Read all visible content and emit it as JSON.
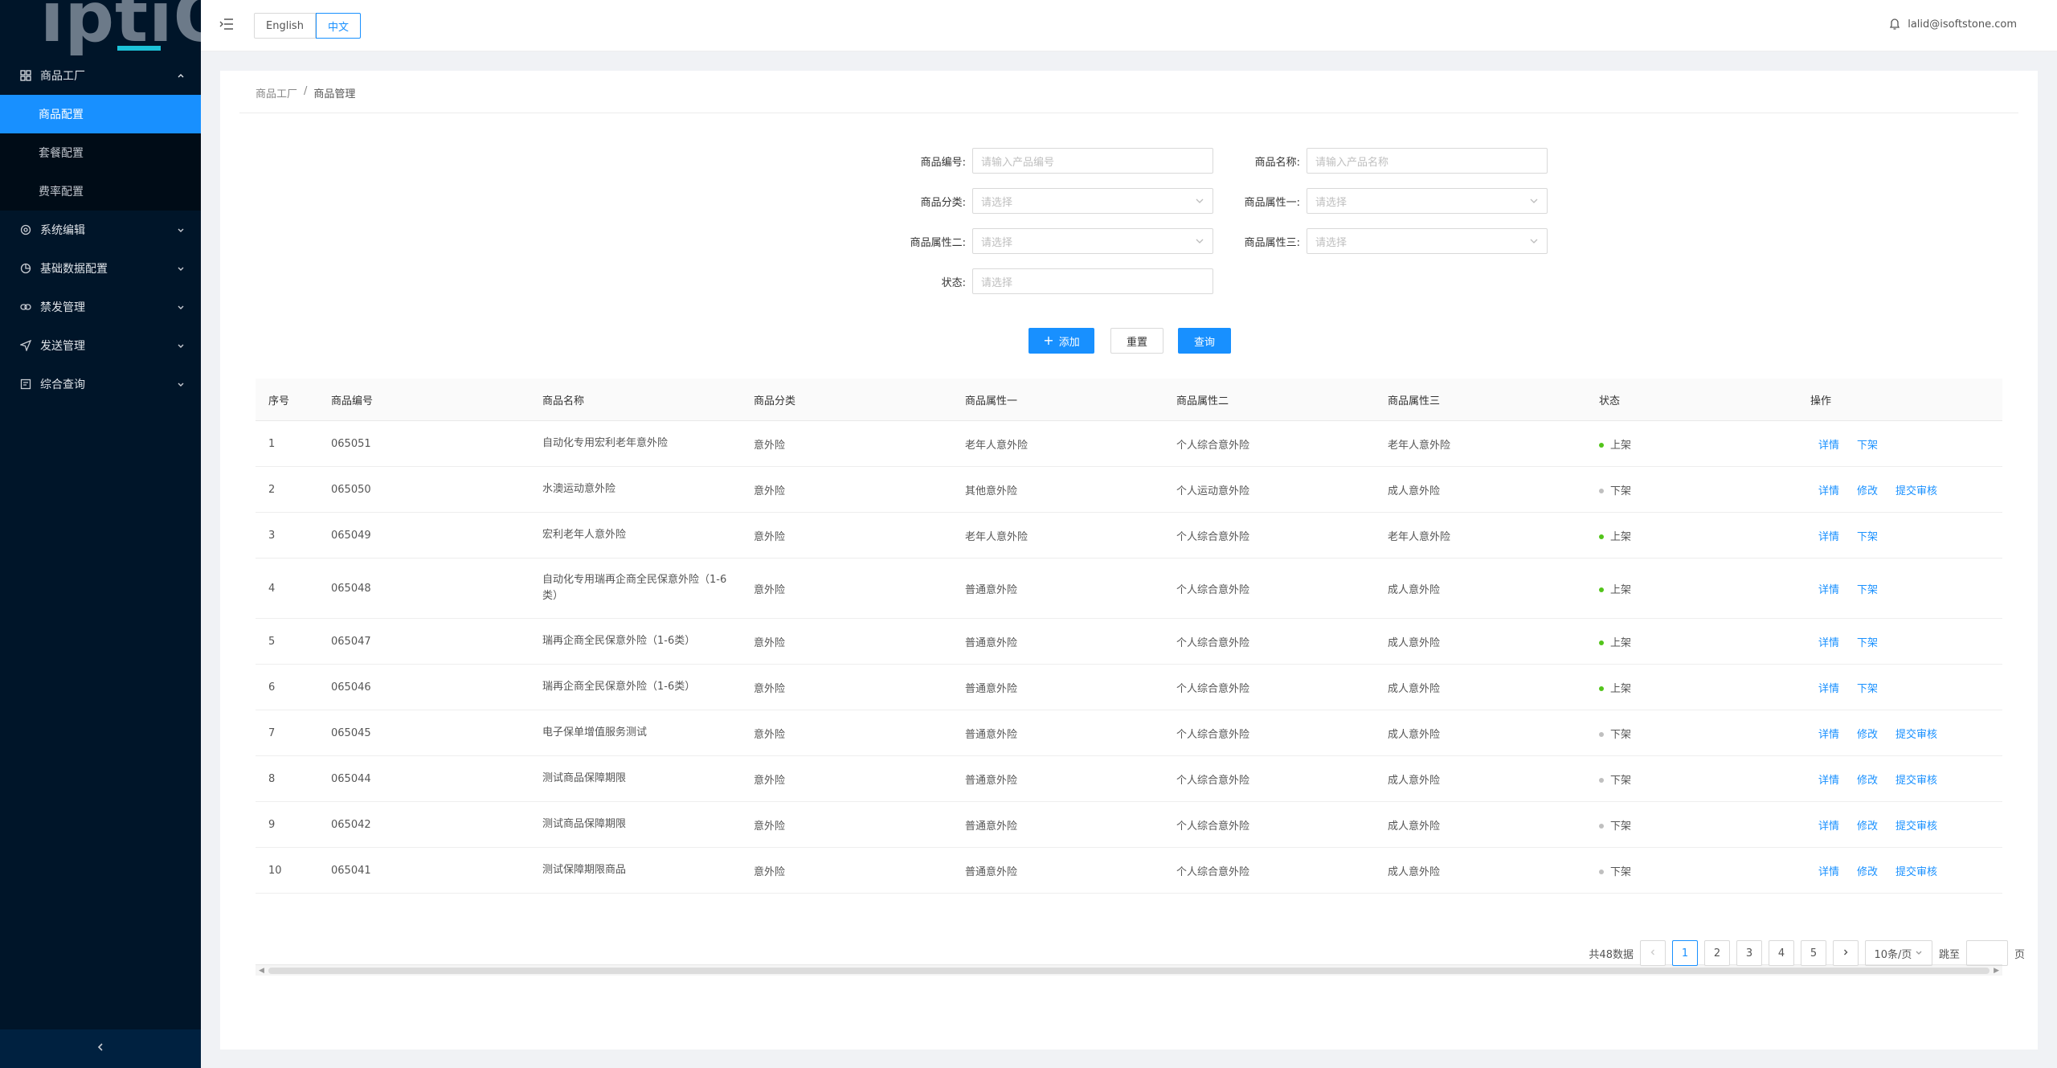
{
  "logo": {
    "text": "iptiQ"
  },
  "sidebar": {
    "groups": [
      {
        "label": "商品工厂",
        "icon": "grid-icon",
        "expanded": true
      },
      {
        "label": "系统编辑",
        "icon": "settings-icon"
      },
      {
        "label": "基础数据配置",
        "icon": "pie-chart-icon"
      },
      {
        "label": "禁发管理",
        "icon": "link-icon"
      },
      {
        "label": "发送管理",
        "icon": "send-icon"
      },
      {
        "label": "综合查询",
        "icon": "form-icon"
      }
    ],
    "subitems": [
      {
        "label": "商品配置",
        "active": true
      },
      {
        "label": "套餐配置"
      },
      {
        "label": "费率配置"
      }
    ]
  },
  "header": {
    "lang_en": "English",
    "lang_zh": "中文",
    "user": "lalid@isoftstone.com"
  },
  "breadcrumb": {
    "parent": "商品工厂",
    "separator": "/",
    "current": "商品管理"
  },
  "form": {
    "code_label": "商品编号:",
    "code_placeholder": "请输入产品编号",
    "name_label": "商品名称:",
    "name_placeholder": "请输入产品名称",
    "category_label": "商品分类:",
    "category_placeholder": "请选择",
    "attr1_label": "商品属性一:",
    "attr1_placeholder": "请选择",
    "attr2_label": "商品属性二:",
    "attr2_placeholder": "请选择",
    "attr3_label": "商品属性三:",
    "attr3_placeholder": "请选择",
    "status_label": "状态:",
    "status_placeholder": "请选择"
  },
  "buttons": {
    "add": "添加",
    "reset": "重置",
    "query": "查询"
  },
  "table": {
    "columns": [
      "序号",
      "商品编号",
      "商品名称",
      "商品分类",
      "商品属性一",
      "商品属性二",
      "商品属性三",
      "状态",
      "操作"
    ],
    "rows": [
      {
        "no": "1",
        "code": "065051",
        "name": "自动化专用宏利老年意外险",
        "category": "意外险",
        "attr1": "老年人意外险",
        "attr2": "个人综合意外险",
        "attr3": "老年人意外险",
        "status": "上架",
        "on": true,
        "ops": [
          "详情",
          "下架"
        ]
      },
      {
        "no": "2",
        "code": "065050",
        "name": "水澳运动意外险",
        "category": "意外险",
        "attr1": "其他意外险",
        "attr2": "个人运动意外险",
        "attr3": "成人意外险",
        "status": "下架",
        "on": false,
        "ops": [
          "详情",
          "修改",
          "提交审核"
        ]
      },
      {
        "no": "3",
        "code": "065049",
        "name": "宏利老年人意外险",
        "category": "意外险",
        "attr1": "老年人意外险",
        "attr2": "个人综合意外险",
        "attr3": "老年人意外险",
        "status": "上架",
        "on": true,
        "ops": [
          "详情",
          "下架"
        ]
      },
      {
        "no": "4",
        "code": "065048",
        "name": "自动化专用瑞再企商全民保意外险（1-6类）",
        "category": "意外险",
        "attr1": "普通意外险",
        "attr2": "个人综合意外险",
        "attr3": "成人意外险",
        "status": "上架",
        "on": true,
        "ops": [
          "详情",
          "下架"
        ],
        "tall": true
      },
      {
        "no": "5",
        "code": "065047",
        "name": "瑞再企商全民保意外险（1-6类）",
        "category": "意外险",
        "attr1": "普通意外险",
        "attr2": "个人综合意外险",
        "attr3": "成人意外险",
        "status": "上架",
        "on": true,
        "ops": [
          "详情",
          "下架"
        ]
      },
      {
        "no": "6",
        "code": "065046",
        "name": "瑞再企商全民保意外险（1-6类）",
        "category": "意外险",
        "attr1": "普通意外险",
        "attr2": "个人综合意外险",
        "attr3": "成人意外险",
        "status": "上架",
        "on": true,
        "ops": [
          "详情",
          "下架"
        ]
      },
      {
        "no": "7",
        "code": "065045",
        "name": "电子保单增值服务测试",
        "category": "意外险",
        "attr1": "普通意外险",
        "attr2": "个人综合意外险",
        "attr3": "成人意外险",
        "status": "下架",
        "on": false,
        "ops": [
          "详情",
          "修改",
          "提交审核"
        ]
      },
      {
        "no": "8",
        "code": "065044",
        "name": "测试商品保障期限",
        "category": "意外险",
        "attr1": "普通意外险",
        "attr2": "个人综合意外险",
        "attr3": "成人意外险",
        "status": "下架",
        "on": false,
        "ops": [
          "详情",
          "修改",
          "提交审核"
        ]
      },
      {
        "no": "9",
        "code": "065042",
        "name": "测试商品保障期限",
        "category": "意外险",
        "attr1": "普通意外险",
        "attr2": "个人综合意外险",
        "attr3": "成人意外险",
        "status": "下架",
        "on": false,
        "ops": [
          "详情",
          "修改",
          "提交审核"
        ]
      },
      {
        "no": "10",
        "code": "065041",
        "name": "测试保障期限商品",
        "category": "意外险",
        "attr1": "普通意外险",
        "attr2": "个人综合意外险",
        "attr3": "成人意外险",
        "status": "下架",
        "on": false,
        "ops": [
          "详情",
          "修改",
          "提交审核"
        ]
      }
    ]
  },
  "pagination": {
    "total": "共48数据",
    "pages": [
      "1",
      "2",
      "3",
      "4",
      "5"
    ],
    "current": "1",
    "page_size": "10条/页",
    "jump_label": "跳至",
    "page_suffix": "页"
  },
  "colors": {
    "primary": "#1890ff",
    "sidebar": "#001529",
    "status_on": "#52c41a",
    "status_off": "#bfbfbf"
  }
}
